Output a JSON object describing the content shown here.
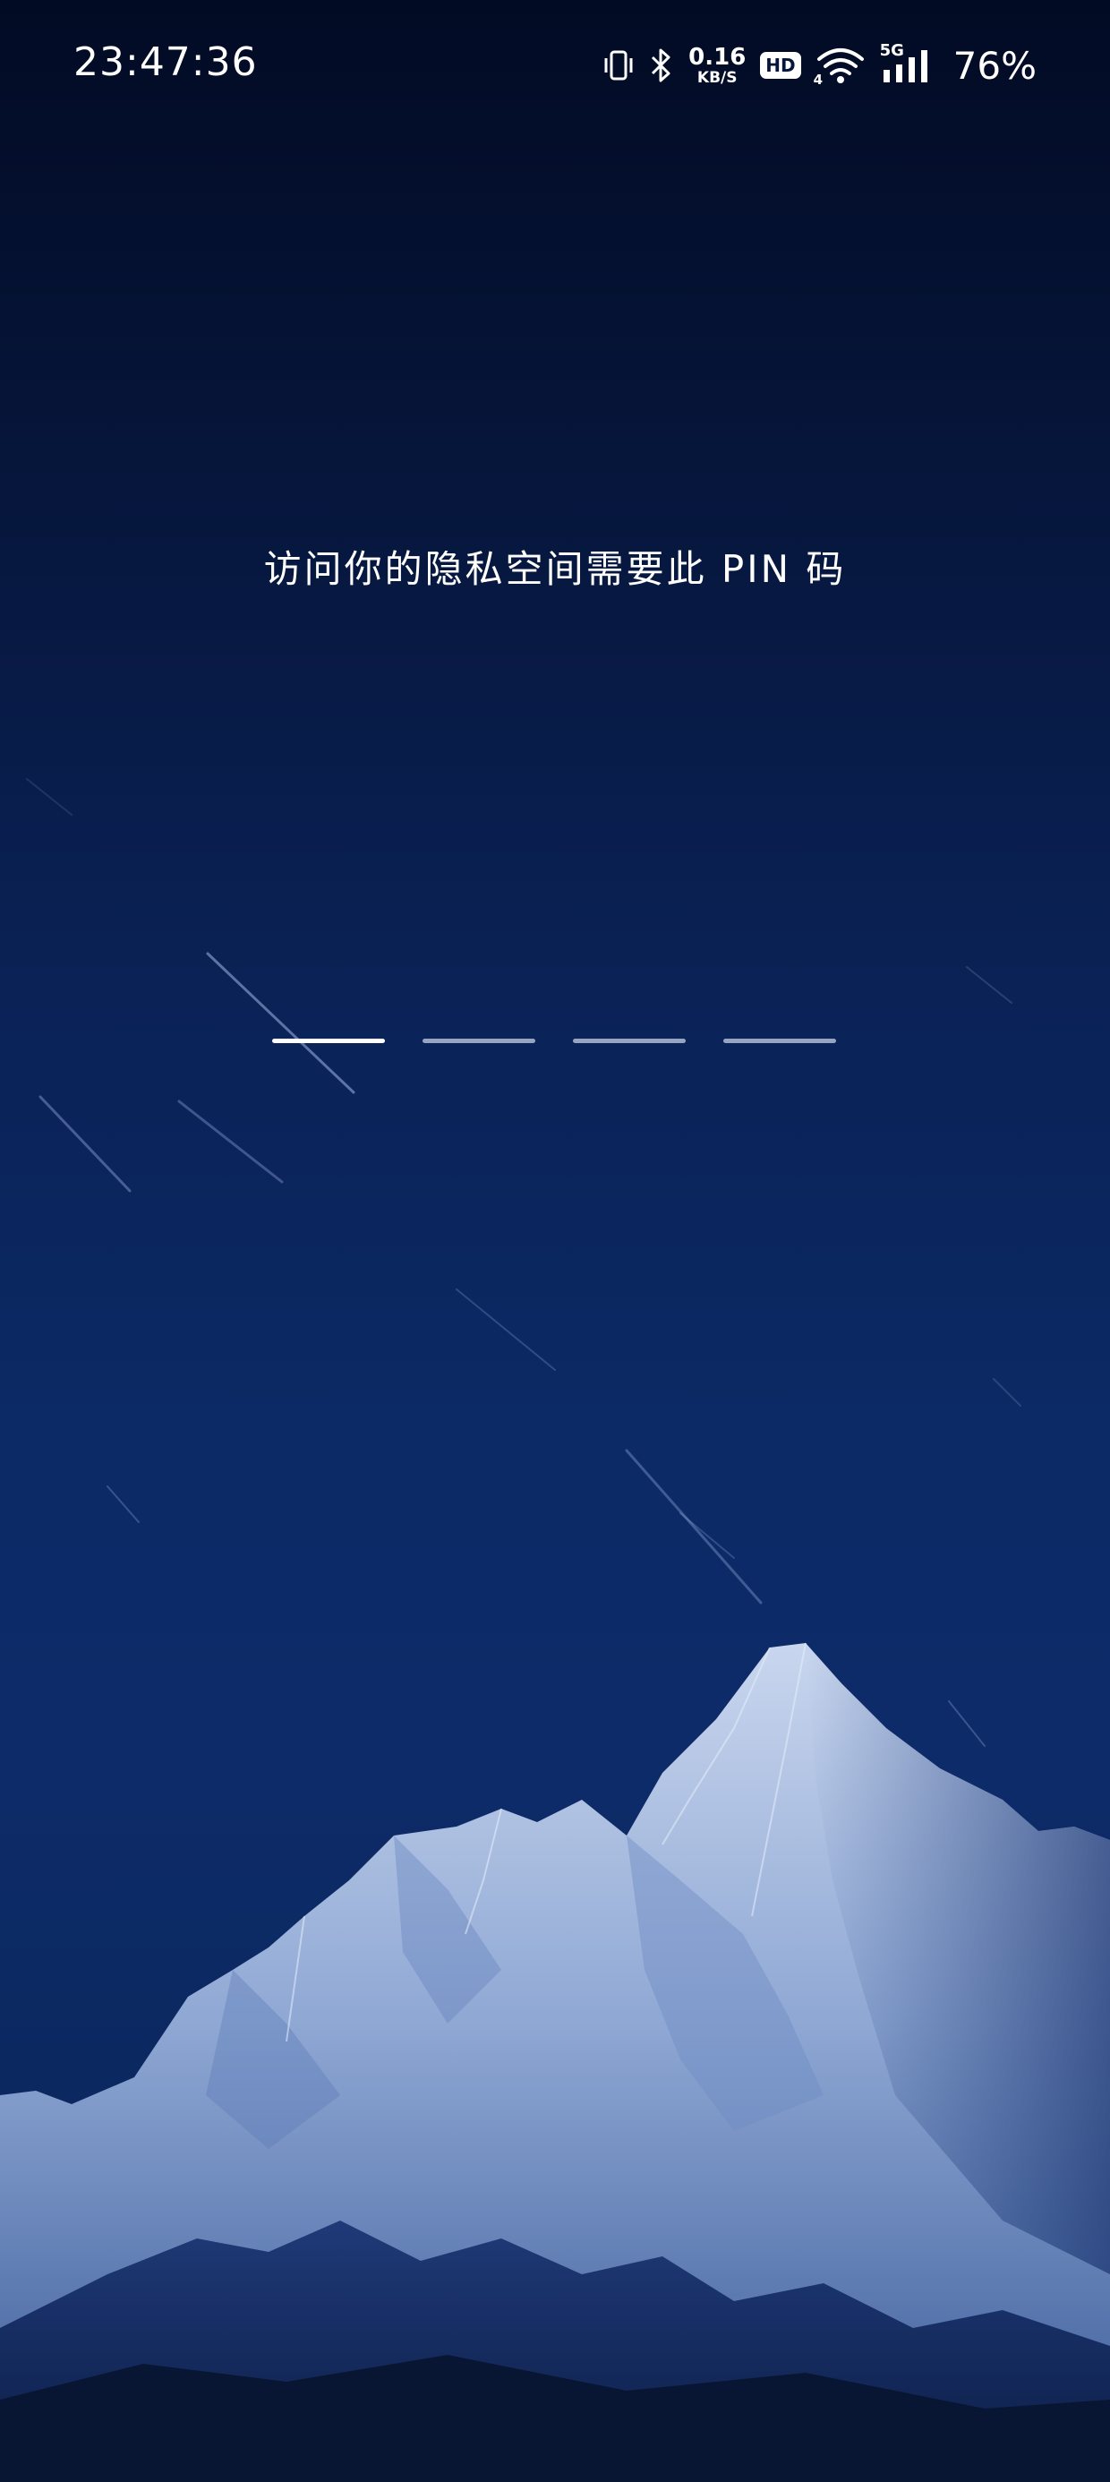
{
  "status_bar": {
    "time": "23:47:36",
    "net_speed_value": "0.16",
    "net_speed_unit": "KB/S",
    "hd_label": "HD",
    "wifi_badge": "4",
    "cellular_label": "5G",
    "battery_percent": "76%",
    "icons": [
      "vibrate-icon",
      "bluetooth-icon",
      "hd-icon",
      "wifi-icon",
      "signal-icon"
    ]
  },
  "lock": {
    "prompt": "访问你的隐私空间需要此 PIN 码",
    "pin_length": 4,
    "pin_entered": 0,
    "active_slot": 0
  },
  "colors": {
    "sky_top": "#020b24",
    "sky_bottom": "#0d2b68",
    "active_slot": "#ffffff",
    "inactive_slot": "#c8d2e6"
  }
}
